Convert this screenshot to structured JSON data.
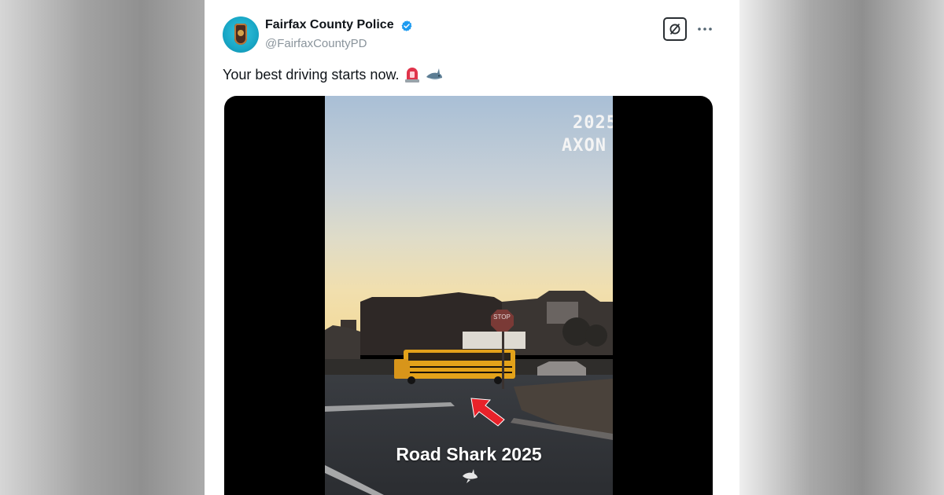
{
  "tweet": {
    "display_name": "Fairfax County Police",
    "handle": "@FairfaxCountyPD",
    "verified": true,
    "text": "Your best driving starts now.",
    "emojis": [
      "police-siren-icon",
      "shark-icon"
    ]
  },
  "actions": {
    "grok_icon": "grok-icon",
    "more_icon": "more-icon"
  },
  "video": {
    "overlay_year": "2025",
    "overlay_brand": "AXON",
    "stop_sign": "STOP",
    "caption": "Road Shark 2025"
  },
  "colors": {
    "verified_blue": "#1d9bf0",
    "arrow_red": "#e8222a",
    "bus_yellow": "#e3a21a",
    "avatar_teal": "#1ea9c9"
  }
}
